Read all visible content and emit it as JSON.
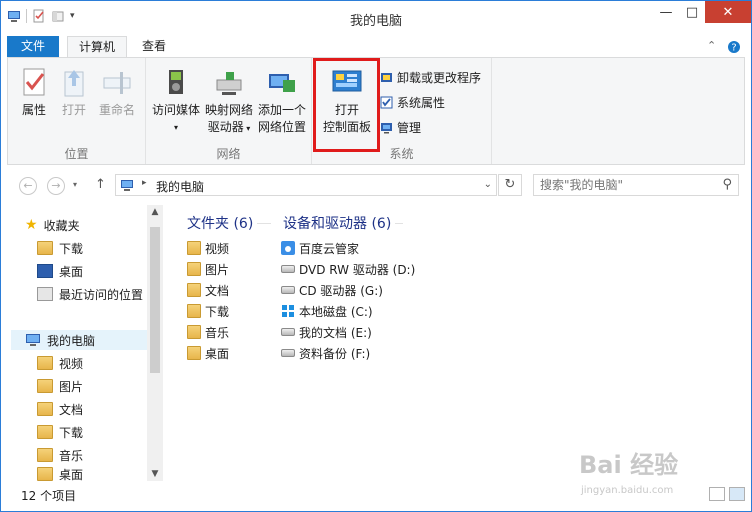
{
  "window": {
    "title": "我的电脑",
    "controls": {
      "minimize": "—",
      "maximize": "□",
      "close": "✕"
    }
  },
  "ribbon": {
    "tabs": [
      {
        "label": "文件",
        "active": false
      },
      {
        "label": "计算机",
        "active": true
      },
      {
        "label": "查看",
        "active": false
      }
    ],
    "collapse_icon": "chevron-up-icon",
    "help_icon": "help-icon",
    "groups": {
      "location": {
        "label": "位置",
        "buttons": [
          {
            "label": "属性",
            "icon": "properties-icon",
            "enabled": true
          },
          {
            "label": "打开",
            "icon": "open-icon",
            "enabled": false
          },
          {
            "label": "重命名",
            "icon": "rename-icon",
            "enabled": false
          }
        ]
      },
      "network": {
        "label": "网络",
        "buttons": [
          {
            "line1": "访问媒体",
            "icon": "media-icon"
          },
          {
            "line1": "映射网络",
            "line2": "驱动器",
            "icon": "map-drive-icon"
          },
          {
            "line1": "添加一个",
            "line2": "网络位置",
            "icon": "network-location-icon"
          }
        ]
      },
      "system": {
        "label": "系统",
        "open_control_panel": {
          "line1": "打开",
          "line2": "控制面板",
          "icon": "control-panel-icon"
        },
        "small_buttons": [
          {
            "label": "卸载或更改程序",
            "icon": "uninstall-icon"
          },
          {
            "label": "系统属性",
            "icon": "system-properties-icon"
          },
          {
            "label": "管理",
            "icon": "manage-icon"
          }
        ]
      }
    }
  },
  "address": {
    "path": "我的电脑",
    "search_placeholder": "搜索\"我的电脑\""
  },
  "nav_pane": {
    "favorites": {
      "label": "收藏夹",
      "items": [
        "下载",
        "桌面",
        "最近访问的位置"
      ]
    },
    "computer": {
      "label": "我的电脑",
      "items": [
        "视频",
        "图片",
        "文档",
        "下载",
        "音乐",
        "桌面"
      ]
    }
  },
  "content": {
    "folders_header": "文件夹 (6)",
    "folders": [
      "视频",
      "图片",
      "文档",
      "下载",
      "音乐",
      "桌面"
    ],
    "devices_header": "设备和驱动器 (6)",
    "devices": [
      "百度云管家",
      "DVD RW 驱动器 (D:)",
      "CD 驱动器 (G:)",
      "本地磁盘 (C:)",
      "我的文档 (E:)",
      "资料备份 (F:)"
    ]
  },
  "status": {
    "item_count": "12 个项目"
  },
  "watermark": {
    "brand": "Bai 经验",
    "url": "jingyan.baidu.com"
  },
  "colors": {
    "accent": "#1979ca",
    "highlight": "#e01b1b",
    "close": "#c84031"
  }
}
